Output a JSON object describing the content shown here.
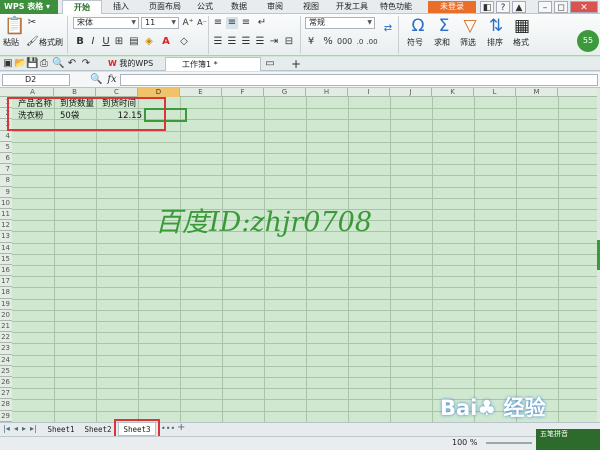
{
  "app": {
    "name": "WPS 表格"
  },
  "menu": {
    "tabs": [
      "开始",
      "插入",
      "页面布局",
      "公式",
      "数据",
      "审阅",
      "视图",
      "开发工具",
      "特色功能"
    ],
    "active": "开始",
    "login": "未登录"
  },
  "ribbon": {
    "paste": "粘贴",
    "format_painter": "格式刷",
    "font_name": "宋体",
    "font_size": "11",
    "number_format": "常规",
    "symbol": "符号",
    "sum": "求和",
    "filter": "筛选",
    "sort": "排序",
    "format": "格式",
    "find": "点此查找命令",
    "side_num": "55"
  },
  "quick_tabs": {
    "my_wps": "我的WPS",
    "doc": "工作簿1 *"
  },
  "formula_bar": {
    "name_box": "D2",
    "fx": "fx",
    "value": ""
  },
  "columns": [
    "A",
    "B",
    "C",
    "D",
    "E",
    "F",
    "G",
    "H",
    "I",
    "J",
    "K",
    "L",
    "M"
  ],
  "selected_column": "D",
  "rows": 29,
  "cells": {
    "A1": "产品名称",
    "B1": "到货数量",
    "C1": "到货时间",
    "A2": "洗衣粉",
    "B2": "50袋",
    "C2": "12.15"
  },
  "watermark": "百度ID:zhjr0708",
  "sheets": [
    "Sheet1",
    "Sheet2",
    "Sheet3"
  ],
  "active_sheet": "Sheet3",
  "status": {
    "zoom": "100 %"
  },
  "overlay": {
    "baidu": "Bai♣ 经验",
    "ime": "五笔拼音"
  },
  "colors": {
    "accent": "#3c9a3c",
    "highlight_box": "#d9353a",
    "grid_bg": "#cfe8cf"
  }
}
